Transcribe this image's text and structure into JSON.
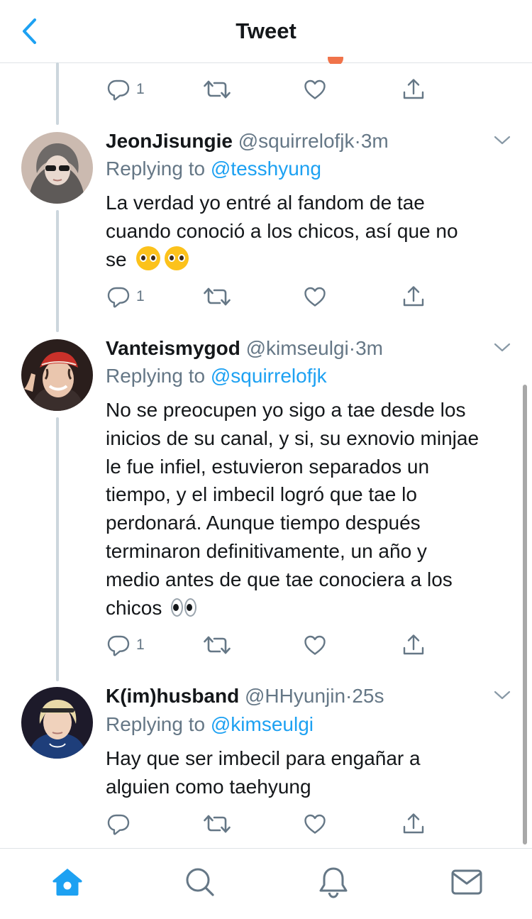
{
  "header": {
    "title": "Tweet",
    "back_icon": "chevron-left-icon"
  },
  "colors": {
    "accent": "#1da1f2",
    "text": "#14171a",
    "muted": "#657786"
  },
  "previous_tweet": {
    "reply_count": "1"
  },
  "tweets": [
    {
      "display_name": "JeonJisungie",
      "handle": "@squirrelofjk",
      "separator": "·",
      "time": "3m",
      "replying_prefix": "Replying to",
      "replying_to": "@tesshyung",
      "text_lines": [
        "La verdad yo entré al fandom de tae",
        "cuando conoció a los chicos, así que no",
        "se"
      ],
      "trailing_emoji": [
        "pleading-face",
        "pleading-face"
      ],
      "reply_count": "1"
    },
    {
      "display_name": "Vanteismygod",
      "handle": "@kimseulgi",
      "separator": "·",
      "time": "3m",
      "replying_prefix": "Replying to",
      "replying_to": "@squirrelofjk",
      "text_lines": [
        "No se preocupen yo sigo a tae desde los",
        "inicios de su canal, y si, su exnovio minjae",
        "le fue infiel, estuvieron separados un",
        "tiempo, y el imbecil logró que tae lo",
        "perdonará. Aunque tiempo después",
        "terminaron definitivamente, un año y",
        "medio antes de que tae conociera a los",
        "chicos"
      ],
      "trailing_emoji": [
        "eyes"
      ],
      "reply_count": "1"
    },
    {
      "display_name": "K(im)husband",
      "handle": "@HHyunjin",
      "separator": "·",
      "time": "25s",
      "replying_prefix": "Replying to",
      "replying_to": "@kimseulgi",
      "text_lines": [
        "Hay que ser imbecil para engañar a",
        "alguien como taehyung"
      ],
      "trailing_emoji": [],
      "reply_count": ""
    }
  ],
  "tabbar": {
    "items": [
      {
        "name": "home",
        "icon": "home-icon",
        "active": true
      },
      {
        "name": "search",
        "icon": "search-icon",
        "active": false
      },
      {
        "name": "notifications",
        "icon": "bell-icon",
        "active": false
      },
      {
        "name": "messages",
        "icon": "mail-icon",
        "active": false
      }
    ]
  }
}
